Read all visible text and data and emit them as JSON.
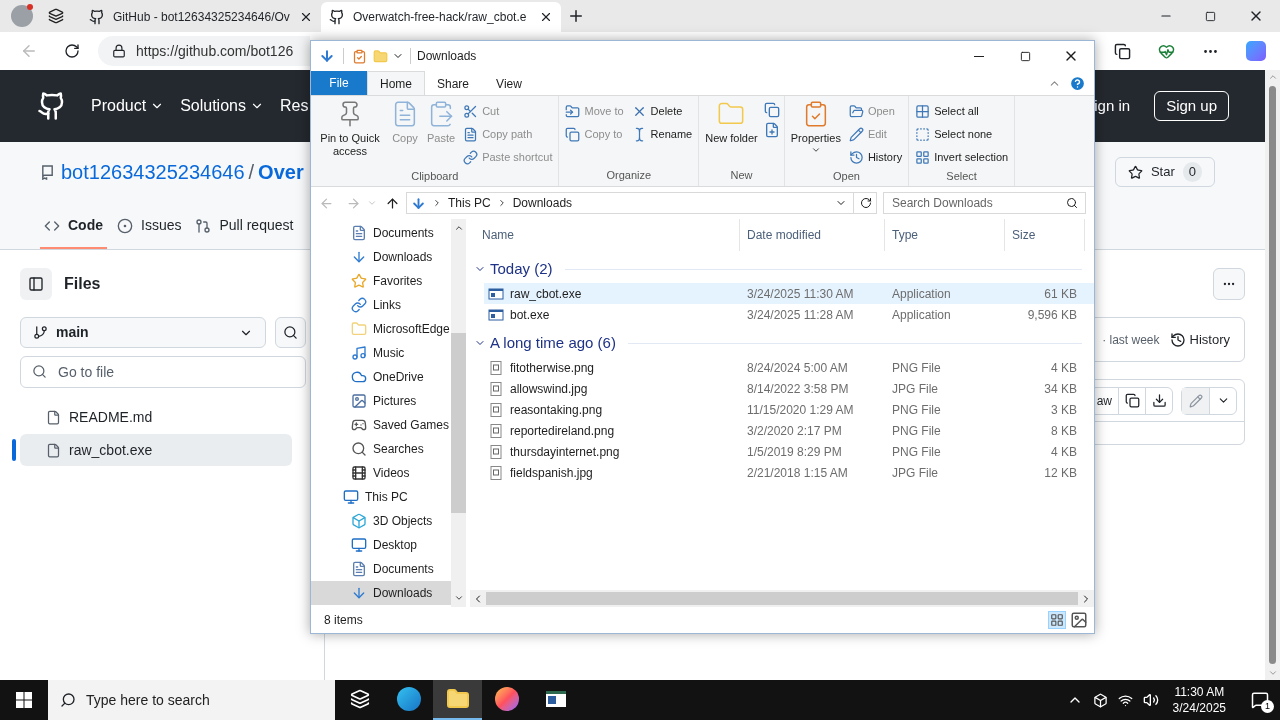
{
  "browser": {
    "tabs": [
      {
        "title": "GitHub - bot12634325234646/Ov",
        "selected": false
      },
      {
        "title": "Overwatch-free-hack/raw_cbot.e",
        "selected": true
      }
    ],
    "url": "https://github.com/bot126"
  },
  "github": {
    "nav": [
      "Product",
      "Solutions",
      "Res"
    ],
    "sign_in": "ign in",
    "sign_up": "Sign up",
    "owner": "bot12634325234646",
    "separator": "/",
    "repo": "Over",
    "repo_tabs": [
      {
        "label": "Code",
        "selected": true
      },
      {
        "label": "Issues",
        "selected": false
      },
      {
        "label": "Pull request",
        "selected": false
      }
    ],
    "star": {
      "label": "Star",
      "count": "0"
    },
    "files_title": "Files",
    "branch": "main",
    "go_to_file": {
      "placeholder": "Go to file"
    },
    "tree": [
      {
        "name": "README.md",
        "selected": false
      },
      {
        "name": "raw_cbot.exe",
        "selected": true
      }
    ],
    "commit_age": "· last week",
    "history": "History",
    "raw": "aw"
  },
  "explorer": {
    "title": "Downloads",
    "ribbon_tabs": [
      {
        "label": "File",
        "kind": "file",
        "selected": false
      },
      {
        "label": "Home",
        "kind": "tab",
        "selected": true
      },
      {
        "label": "Share",
        "kind": "tab",
        "selected": false
      },
      {
        "label": "View",
        "kind": "tab",
        "selected": false
      }
    ],
    "ribbon_groups": [
      {
        "label": "Clipboard",
        "large": [
          {
            "label": "Pin to Quick access",
            "disabled": false
          },
          {
            "label": "Copy",
            "disabled": true
          },
          {
            "label": "Paste",
            "disabled": true
          }
        ],
        "columns": [
          [
            {
              "label": "Cut",
              "disabled": true
            },
            {
              "label": "Copy path",
              "disabled": true
            },
            {
              "label": "Paste shortcut",
              "disabled": true
            }
          ]
        ]
      },
      {
        "label": "Organize",
        "columns": [
          [
            {
              "label": "Move to",
              "disabled": true
            },
            {
              "label": "Copy to",
              "disabled": true
            }
          ],
          [
            {
              "label": "Delete",
              "disabled": false
            },
            {
              "label": "Rename",
              "disabled": false
            }
          ]
        ]
      },
      {
        "label": "New",
        "large": [
          {
            "label": "New folder",
            "disabled": false
          }
        ]
      },
      {
        "label": "Open",
        "large": [
          {
            "label": "Properties",
            "disabled": false
          }
        ],
        "columns": [
          [
            {
              "label": "Open",
              "disabled": true
            },
            {
              "label": "Edit",
              "disabled": true
            },
            {
              "label": "History",
              "disabled": false
            }
          ]
        ]
      },
      {
        "label": "Select",
        "columns": [
          [
            {
              "label": "Select all",
              "disabled": false
            },
            {
              "label": "Select none",
              "disabled": false
            },
            {
              "label": "Invert selection",
              "disabled": false
            }
          ]
        ]
      }
    ],
    "breadcrumbs": [
      "This PC",
      "Downloads"
    ],
    "search": {
      "placeholder": "Search Downloads"
    },
    "nav": {
      "items": [
        {
          "label": "Documents",
          "selected": false
        },
        {
          "label": "Downloads",
          "selected": false
        },
        {
          "label": "Favorites",
          "selected": false
        },
        {
          "label": "Links",
          "selected": false
        },
        {
          "label": "MicrosoftEdge",
          "selected": false
        },
        {
          "label": "Music",
          "selected": false
        },
        {
          "label": "OneDrive",
          "selected": false
        },
        {
          "label": "Pictures",
          "selected": false
        },
        {
          "label": "Saved Games",
          "selected": false
        },
        {
          "label": "Searches",
          "selected": false
        },
        {
          "label": "Videos",
          "selected": false
        }
      ],
      "tree": [
        {
          "label": "This PC",
          "selected": false,
          "children": [
            {
              "label": "3D Objects",
              "selected": false
            },
            {
              "label": "Desktop",
              "selected": false
            },
            {
              "label": "Documents",
              "selected": false
            },
            {
              "label": "Downloads",
              "selected": true
            }
          ]
        }
      ]
    },
    "columns": [
      "Name",
      "Date modified",
      "Type",
      "Size"
    ],
    "groups": [
      {
        "label": "Today (2)",
        "expanded": true,
        "files": [
          {
            "name": "raw_cbot.exe",
            "date": "3/24/2025 11:30 AM",
            "type": "Application",
            "size": "61 KB",
            "kind": "exe",
            "selected": true
          },
          {
            "name": "bot.exe",
            "date": "3/24/2025 11:28 AM",
            "type": "Application",
            "size": "9,596 KB",
            "kind": "exe",
            "selected": false
          }
        ]
      },
      {
        "label": "A long time ago (6)",
        "expanded": true,
        "files": [
          {
            "name": "fitotherwise.png",
            "date": "8/24/2024 5:00 AM",
            "type": "PNG File",
            "size": "4 KB",
            "kind": "image",
            "selected": false
          },
          {
            "name": "allowswind.jpg",
            "date": "8/14/2022 3:58 PM",
            "type": "JPG File",
            "size": "34 KB",
            "kind": "image",
            "selected": false
          },
          {
            "name": "reasontaking.png",
            "date": "11/15/2020 1:29 AM",
            "type": "PNG File",
            "size": "3 KB",
            "kind": "image",
            "selected": false
          },
          {
            "name": "reportedireland.png",
            "date": "3/2/2020 2:17 PM",
            "type": "PNG File",
            "size": "8 KB",
            "kind": "image",
            "selected": false
          },
          {
            "name": "thursdayinternet.png",
            "date": "1/5/2019 8:29 PM",
            "type": "PNG File",
            "size": "4 KB",
            "kind": "image",
            "selected": false
          },
          {
            "name": "fieldspanish.jpg",
            "date": "2/21/2018 1:15 AM",
            "type": "JPG File",
            "size": "12 KB",
            "kind": "image",
            "selected": false
          }
        ]
      }
    ],
    "status": "8 items"
  },
  "taskbar": {
    "search": {
      "placeholder": "Type here to search"
    },
    "apps": [
      {
        "kind": "task-view",
        "active": false
      },
      {
        "kind": "edge",
        "active": false
      },
      {
        "kind": "explorer",
        "active": true
      },
      {
        "kind": "firefox",
        "active": false
      },
      {
        "kind": "app",
        "active": false
      }
    ],
    "time": "11:30 AM",
    "date": "3/24/2025",
    "notifications": "1"
  }
}
